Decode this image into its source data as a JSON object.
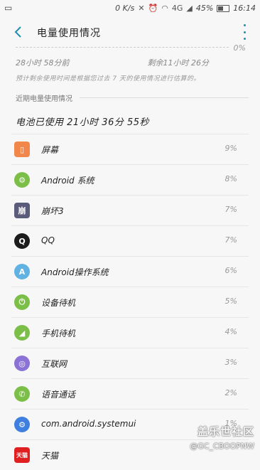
{
  "status_bar": {
    "speed": "0 K/s",
    "network": "4G",
    "battery_pct": "45%",
    "battery_level": 0.45,
    "time": "16:14"
  },
  "header": {
    "title": "电量使用情况"
  },
  "graph": {
    "zero_label": "0%",
    "time_used": "28小时 58分前",
    "time_remaining": "剩余11小时 26分",
    "estimate_note": "预计剩余使用时间是根据您过去 7 天的使用情况进行估算的。"
  },
  "recent_section": {
    "header": "近期电量使用情况",
    "battery_used": "电池已使用 21小时 36分 55秒"
  },
  "apps": [
    {
      "name": "屏幕",
      "pct": "9%",
      "icon": "screen-icon",
      "color": "#f2874b",
      "glyph": "▯"
    },
    {
      "name": "Android 系统",
      "pct": "8%",
      "icon": "gear-icon",
      "color": "#7bbf48",
      "glyph": "⚙"
    },
    {
      "name": "崩坏3",
      "pct": "7%",
      "icon": "honkai-game-icon",
      "color": "#5b5b7a",
      "glyph": "崩"
    },
    {
      "name": "QQ",
      "pct": "7%",
      "icon": "qq-penguin-icon",
      "color": "#1c1c1c",
      "glyph": "Q"
    },
    {
      "name": "Android操作系统",
      "pct": "6%",
      "icon": "android-robot-icon",
      "color": "#5fb2e2",
      "glyph": "A"
    },
    {
      "name": "设备待机",
      "pct": "5%",
      "icon": "power-icon",
      "color": "#7bbf48",
      "glyph": "⏻"
    },
    {
      "name": "手机待机",
      "pct": "4%",
      "icon": "signal-icon",
      "color": "#7bbf48",
      "glyph": "◢"
    },
    {
      "name": "互联网",
      "pct": "3%",
      "icon": "internet-browser-icon",
      "color": "#8b72d6",
      "glyph": "◎"
    },
    {
      "name": "语音通话",
      "pct": "2%",
      "icon": "phone-call-icon",
      "color": "#7bbf48",
      "glyph": "✆"
    },
    {
      "name": "com.android.systemui",
      "pct": "1%",
      "icon": "settings-gear-icon",
      "color": "#3f7fe0",
      "glyph": "⚙"
    },
    {
      "name": "天猫",
      "pct": "",
      "icon": "tmall-icon",
      "color": "#e02020",
      "glyph": "天猫"
    }
  ],
  "watermark": {
    "title": "盖乐世社区",
    "user": "@GC_CBOOPNW"
  }
}
